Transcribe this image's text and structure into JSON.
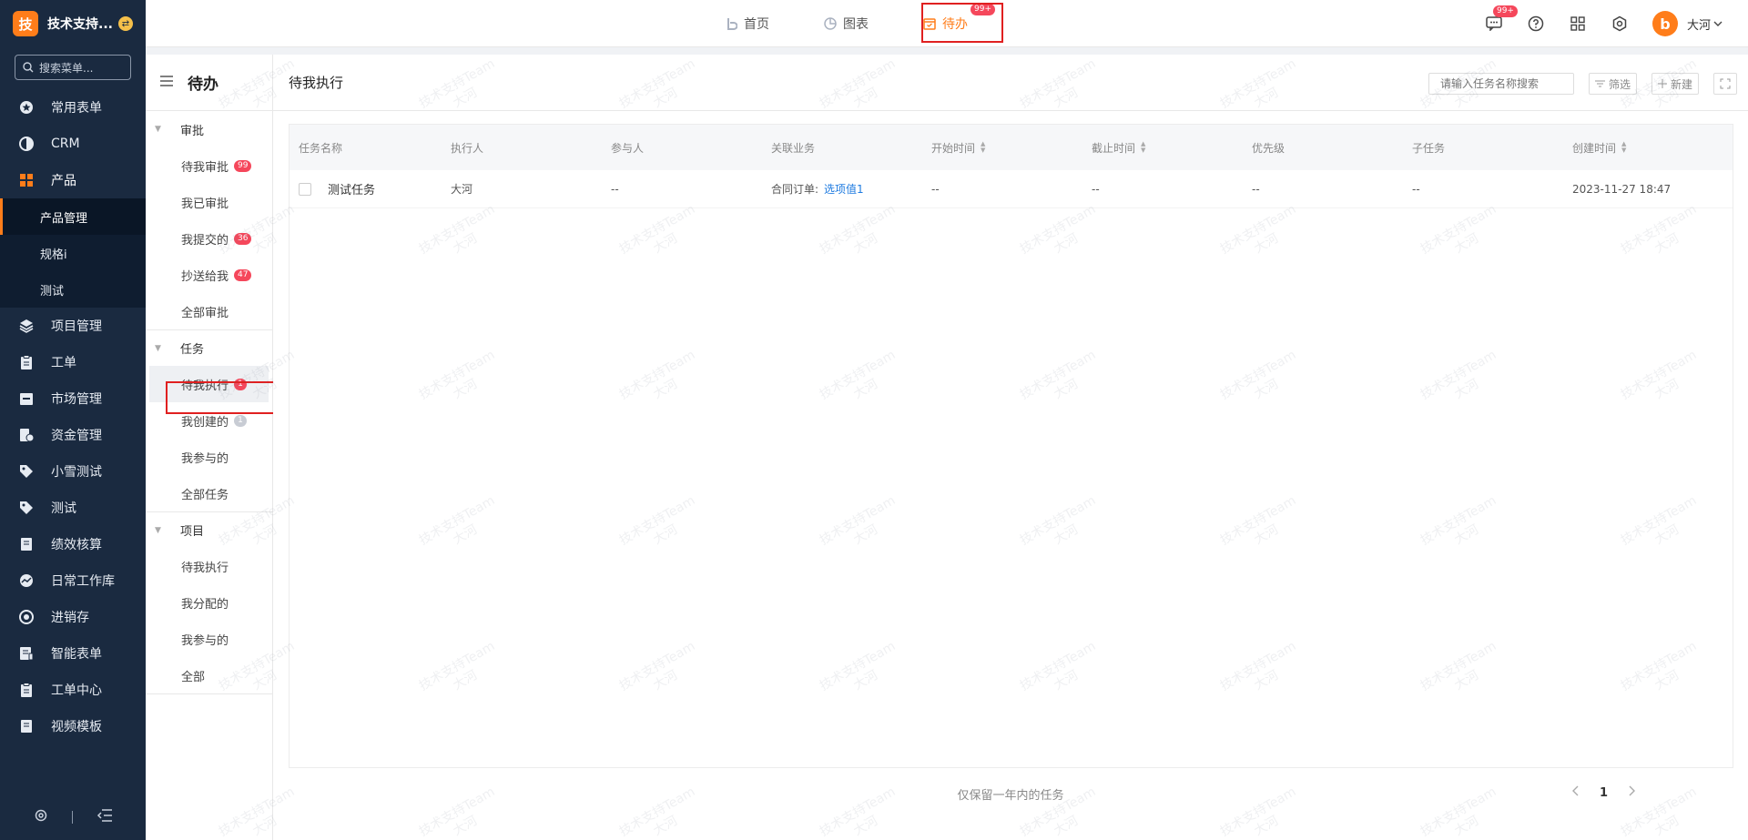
{
  "brand": {
    "logo_char": "技",
    "name": "技术支持..."
  },
  "sidebar": {
    "search_placeholder": "搜索菜单...",
    "items": [
      {
        "label": "常用表单",
        "icon": "star-icon"
      },
      {
        "label": "CRM",
        "icon": "pie-icon"
      },
      {
        "label": "产品",
        "icon": "grid-icon"
      },
      {
        "label": "项目管理",
        "icon": "layers-icon"
      },
      {
        "label": "工单",
        "icon": "clipboard-icon"
      },
      {
        "label": "市场管理",
        "icon": "shop-icon"
      },
      {
        "label": "资金管理",
        "icon": "money-icon"
      },
      {
        "label": "小雪测试",
        "icon": "tag-icon"
      },
      {
        "label": "测试",
        "icon": "tag-icon"
      },
      {
        "label": "绩效核算",
        "icon": "doc-icon"
      },
      {
        "label": "日常工作库",
        "icon": "gauge-icon"
      },
      {
        "label": "进销存",
        "icon": "cycle-icon"
      },
      {
        "label": "智能表单",
        "icon": "form-icon"
      },
      {
        "label": "工单中心",
        "icon": "clipboard-icon"
      },
      {
        "label": "视频模板",
        "icon": "doc-icon"
      }
    ],
    "sub_items": [
      {
        "label": "产品管理"
      },
      {
        "label": "规格i"
      },
      {
        "label": "测试"
      }
    ]
  },
  "topbar": {
    "tabs": [
      {
        "label": "首页"
      },
      {
        "label": "图表"
      },
      {
        "label": "待办",
        "badge": "99+"
      }
    ],
    "msg_badge": "99+",
    "user_avatar": "b",
    "user_name": "大河"
  },
  "panel": {
    "title": "待办",
    "groups": [
      {
        "label": "审批",
        "items": [
          {
            "label": "待我审批",
            "count": "99"
          },
          {
            "label": "我已审批"
          },
          {
            "label": "我提交的",
            "count": "36"
          },
          {
            "label": "抄送给我",
            "count": "47"
          },
          {
            "label": "全部审批"
          }
        ]
      },
      {
        "label": "任务",
        "items": [
          {
            "label": "待我执行",
            "count": "1"
          },
          {
            "label": "我创建的",
            "count": "1"
          },
          {
            "label": "我参与的"
          },
          {
            "label": "全部任务"
          }
        ]
      },
      {
        "label": "项目",
        "items": [
          {
            "label": "待我执行"
          },
          {
            "label": "我分配的"
          },
          {
            "label": "我参与的"
          },
          {
            "label": "全部"
          }
        ]
      }
    ]
  },
  "main": {
    "title": "待我执行",
    "search_placeholder": "请输入任务名称搜索",
    "filter_label": "筛选",
    "new_label": "新建",
    "columns": [
      "任务名称",
      "执行人",
      "参与人",
      "关联业务",
      "开始时间",
      "截止时间",
      "优先级",
      "子任务",
      "创建时间"
    ],
    "rows": [
      {
        "name": "测试任务",
        "executor": "大河",
        "participants": "--",
        "biz_label": "合同订单:",
        "biz_link": "选项值1",
        "start": "--",
        "end": "--",
        "priority": "--",
        "subtask": "--",
        "created": "2023-11-27 18:47"
      }
    ],
    "footer_note": "仅保留一年内的任务",
    "page": "1"
  },
  "watermark": {
    "line1": "技术支持Team",
    "line2": "大河"
  },
  "colors": {
    "accent": "#ff7d1a",
    "sidebar_bg": "#1a2a40",
    "badge": "#f5475b",
    "link": "#1f7be0",
    "highlight": "#e02020"
  }
}
